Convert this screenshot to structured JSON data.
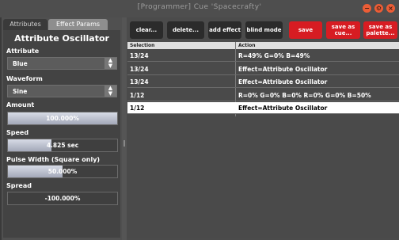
{
  "window": {
    "title": "[Programmer] Cue 'Spacecrafty'",
    "buttons": [
      "−",
      "⚙",
      "×"
    ]
  },
  "tabs": [
    "Attributes",
    "Effect Params"
  ],
  "panel": {
    "title": "Attribute Oscillator",
    "attribute": {
      "label": "Attribute",
      "value": "Blue"
    },
    "waveform": {
      "label": "Waveform",
      "value": "Sine"
    },
    "amount": {
      "label": "Amount",
      "value": "100.000%",
      "fraction": 1.0
    },
    "speed": {
      "label": "Speed",
      "value": "4.825 sec",
      "fraction": 0.4
    },
    "pulse_width": {
      "label": "Pulse Width (Square only)",
      "value": "50.000%",
      "fraction": 0.5
    },
    "spread": {
      "label": "Spread",
      "value": "-100.000%"
    }
  },
  "toolbar": {
    "clear": "clear...",
    "delete": "delete...",
    "add_effect": "add effect",
    "blind_mode": "blind mode",
    "save": "save",
    "save_as_cue": "save as cue...",
    "save_as_palette": "save as palette..."
  },
  "table": {
    "columns": [
      "Selection",
      "Action"
    ],
    "rows": [
      {
        "selection": "13/24",
        "action": "R=49% G=0% B=49%"
      },
      {
        "selection": "13/24",
        "action": "Effect=Attribute Oscillator"
      },
      {
        "selection": "13/24",
        "action": "Effect=Attribute Oscillator"
      },
      {
        "selection": "1/12",
        "action": "R=0% G=0% B=0% R=0% G=0% B=50%"
      },
      {
        "selection": "1/12",
        "action": "Effect=Attribute Oscillator",
        "selected": true
      }
    ]
  },
  "colors": {
    "accent_red": "#d71c22",
    "window_button": "#ec5d36"
  }
}
